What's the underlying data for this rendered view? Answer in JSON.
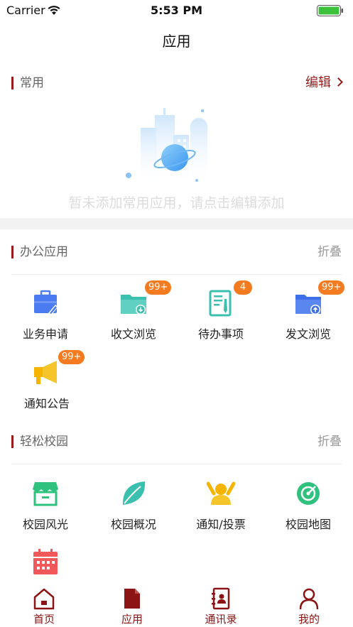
{
  "status_bar": {
    "carrier": "Carrier",
    "time": "5:53 PM"
  },
  "nav": {
    "title": "应用"
  },
  "common": {
    "title": "常用",
    "edit_label": "编辑",
    "empty_text": "暂未添加常用应用，请点击编辑添加"
  },
  "office": {
    "title": "办公应用",
    "collapse_label": "折叠",
    "items": [
      {
        "label": "业务申请",
        "icon": "briefcase-icon",
        "badge": ""
      },
      {
        "label": "收文浏览",
        "icon": "folder-download-icon",
        "badge": "99+"
      },
      {
        "label": "待办事项",
        "icon": "document-pen-icon",
        "badge": "4"
      },
      {
        "label": "发文浏览",
        "icon": "folder-upload-icon",
        "badge": "99+"
      },
      {
        "label": "通知公告",
        "icon": "megaphone-icon",
        "badge": "99+"
      }
    ]
  },
  "campus": {
    "title": "轻松校园",
    "collapse_label": "折叠",
    "items": [
      {
        "label": "校园风光",
        "icon": "storefront-icon"
      },
      {
        "label": "校园概况",
        "icon": "leaf-icon"
      },
      {
        "label": "通知/投票",
        "icon": "people-icon"
      },
      {
        "label": "校园地图",
        "icon": "compass-icon"
      },
      {
        "label": "",
        "icon": "calendar-icon"
      }
    ]
  },
  "tabbar": {
    "items": [
      {
        "label": "首页",
        "icon": "home-icon"
      },
      {
        "label": "应用",
        "icon": "apps-document-icon"
      },
      {
        "label": "通讯录",
        "icon": "contacts-icon"
      },
      {
        "label": "我的",
        "icon": "user-icon"
      }
    ]
  },
  "colors": {
    "accent": "#9b1a1a",
    "badge": "#f47b20",
    "blue": "#4a7bf0",
    "teal": "#3bbfae",
    "yellow": "#f6b400",
    "green": "#2ec27e",
    "red": "#f0585a"
  }
}
